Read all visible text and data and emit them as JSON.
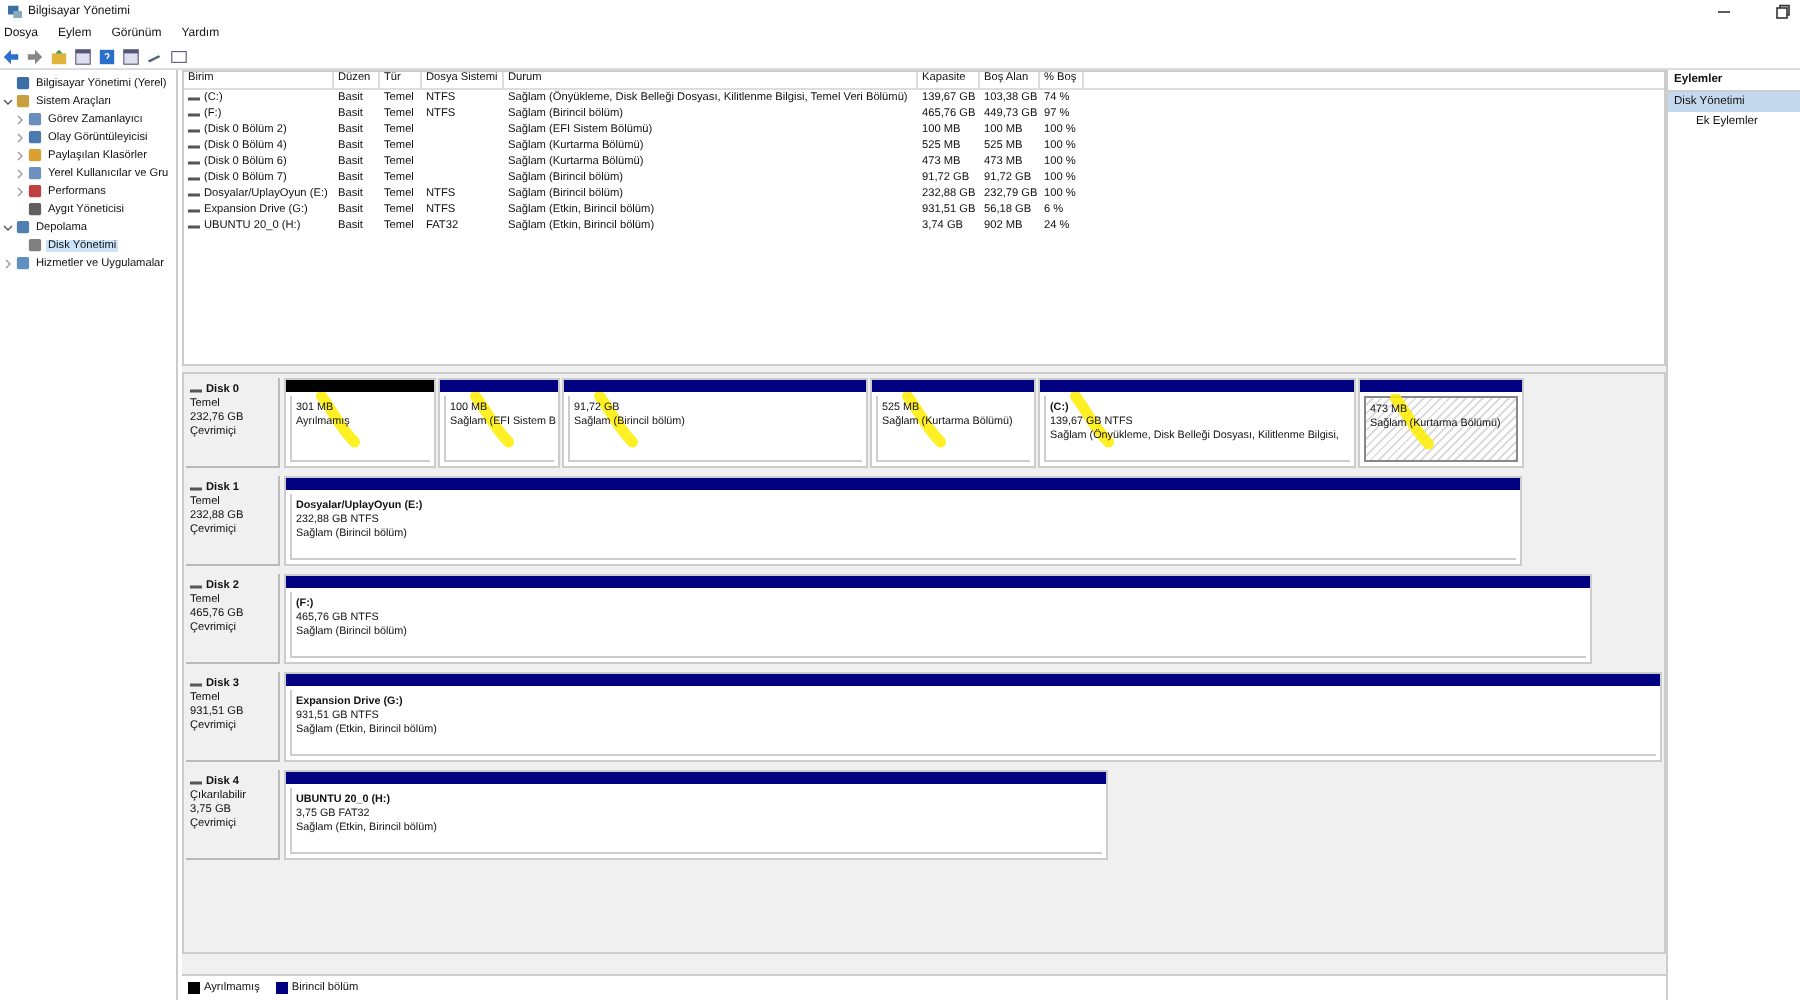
{
  "window": {
    "title": "Bilgisayar Yönetimi"
  },
  "menu": [
    "Dosya",
    "Eylem",
    "Görünüm",
    "Yardım"
  ],
  "tree": [
    {
      "label": "Bilgisayar Yönetimi (Yerel)",
      "selected": false,
      "children": [
        {
          "label": "Sistem Araçları",
          "expanded": true,
          "selected": false,
          "children": [
            {
              "label": "Görev Zamanlayıcı",
              "expanded": false,
              "selected": false
            },
            {
              "label": "Olay Görüntüleyicisi",
              "expanded": false,
              "selected": false
            },
            {
              "label": "Paylaşılan Klasörler",
              "expanded": false,
              "selected": false
            },
            {
              "label": "Yerel Kullanıcılar ve Gru",
              "expanded": false,
              "selected": false
            },
            {
              "label": "Performans",
              "expanded": false,
              "selected": false
            },
            {
              "label": "Aygıt Yöneticisi",
              "selected": false
            }
          ]
        },
        {
          "label": "Depolama",
          "expanded": true,
          "selected": false,
          "children": [
            {
              "label": "Disk Yönetimi",
              "selected": true
            }
          ]
        },
        {
          "label": "Hizmetler ve Uygulamalar",
          "expanded": false,
          "selected": false
        }
      ]
    }
  ],
  "table": {
    "columns": [
      "Birim",
      "Düzen",
      "Tür",
      "Dosya Sistemi",
      "Durum",
      "Kapasite",
      "Boş Alan",
      "% Boş"
    ],
    "rows": [
      [
        "(C:)",
        "Basit",
        "Temel",
        "NTFS",
        "Sağlam (Önyükleme, Disk Belleği Dosyası, Kilitlenme Bilgisi, Temel Veri Bölümü)",
        "139,67 GB",
        "103,38 GB",
        "74 %"
      ],
      [
        "(F:)",
        "Basit",
        "Temel",
        "NTFS",
        "Sağlam (Birincil bölüm)",
        "465,76 GB",
        "449,73 GB",
        "97 %"
      ],
      [
        "(Disk 0 Bölüm 2)",
        "Basit",
        "Temel",
        "",
        "Sağlam (EFI Sistem Bölümü)",
        "100 MB",
        "100 MB",
        "100 %"
      ],
      [
        "(Disk 0 Bölüm 4)",
        "Basit",
        "Temel",
        "",
        "Sağlam (Kurtarma Bölümü)",
        "525 MB",
        "525 MB",
        "100 %"
      ],
      [
        "(Disk 0 Bölüm 6)",
        "Basit",
        "Temel",
        "",
        "Sağlam (Kurtarma Bölümü)",
        "473 MB",
        "473 MB",
        "100 %"
      ],
      [
        "(Disk 0 Bölüm 7)",
        "Basit",
        "Temel",
        "",
        "Sağlam (Birincil bölüm)",
        "91,72 GB",
        "91,72 GB",
        "100 %"
      ],
      [
        "Dosyalar/UplayOyun (E:)",
        "Basit",
        "Temel",
        "NTFS",
        "Sağlam (Birincil bölüm)",
        "232,88 GB",
        "232,79 GB",
        "100 %"
      ],
      [
        "Expansion Drive (G:)",
        "Basit",
        "Temel",
        "NTFS",
        "Sağlam (Etkin, Birincil bölüm)",
        "931,51 GB",
        "56,18 GB",
        "6 %"
      ],
      [
        "UBUNTU 20_0 (H:)",
        "Basit",
        "Temel",
        "FAT32",
        "Sağlam (Etkin, Birincil bölüm)",
        "3,74 GB",
        "902 MB",
        "24 %"
      ]
    ]
  },
  "disks": [
    {
      "name": "Disk 0",
      "type": "Temel",
      "size": "232,76 GB",
      "status": "Çevrimiçi",
      "partitions": [
        {
          "kind": "unallocated",
          "size": "301 MB",
          "status": "Ayrılmamış",
          "selected": false,
          "highlighted": true
        },
        {
          "kind": "primary",
          "size": "100 MB",
          "status": "Sağlam (EFI Sistem B",
          "selected": false,
          "highlighted": true
        },
        {
          "kind": "primary",
          "size": "91,72 GB",
          "status": "Sağlam (Birincil bölüm)",
          "selected": false,
          "highlighted": true
        },
        {
          "kind": "primary",
          "size": "525 MB",
          "status": "Sağlam (Kurtarma Bölümü)",
          "selected": false,
          "highlighted": true
        },
        {
          "kind": "primary",
          "name": "(C:)",
          "size": "139,67 GB NTFS",
          "status": "Sağlam (Önyükleme, Disk Belleği Dosyası, Kilitlenme Bilgisi,",
          "selected": false,
          "highlighted": true
        },
        {
          "kind": "primary",
          "size": "473 MB",
          "status": "Sağlam (Kurtarma Bölümü)",
          "selected": true,
          "highlighted": true
        }
      ]
    },
    {
      "name": "Disk 1",
      "type": "Temel",
      "size": "232,88 GB",
      "status": "Çevrimiçi",
      "partitions": [
        {
          "kind": "primary",
          "name": "Dosyalar/UplayOyun  (E:)",
          "size": "232,88 GB NTFS",
          "status": "Sağlam (Birincil bölüm)",
          "selected": false,
          "highlighted": false
        }
      ]
    },
    {
      "name": "Disk 2",
      "type": "Temel",
      "size": "465,76 GB",
      "status": "Çevrimiçi",
      "partitions": [
        {
          "kind": "primary",
          "name": "(F:)",
          "size": "465,76 GB NTFS",
          "status": "Sağlam (Birincil bölüm)",
          "selected": false,
          "highlighted": false
        }
      ]
    },
    {
      "name": "Disk 3",
      "type": "Temel",
      "size": "931,51 GB",
      "status": "Çevrimiçi",
      "partitions": [
        {
          "kind": "primary",
          "name": "Expansion Drive  (G:)",
          "size": "931,51 GB NTFS",
          "status": "Sağlam (Etkin, Birincil bölüm)",
          "selected": false,
          "highlighted": false
        }
      ]
    },
    {
      "name": "Disk 4",
      "type": "Çıkarılabilir",
      "size": "3,75 GB",
      "status": "Çevrimiçi",
      "partitions": [
        {
          "kind": "primary",
          "name": "UBUNTU 20_0  (H:)",
          "size": "3,75 GB FAT32",
          "status": "Sağlam (Etkin, Birincil bölüm)",
          "selected": false,
          "highlighted": false
        }
      ]
    }
  ],
  "legend": [
    {
      "label": "Ayrılmamış",
      "color": "#000000"
    },
    {
      "label": "Birincil bölüm",
      "color": "#000080"
    }
  ],
  "actions": {
    "title": "Eylemler",
    "items": [
      {
        "label": "Disk Yönetimi",
        "kind": "header"
      },
      {
        "label": "Ek Eylemler",
        "kind": "item"
      }
    ]
  }
}
